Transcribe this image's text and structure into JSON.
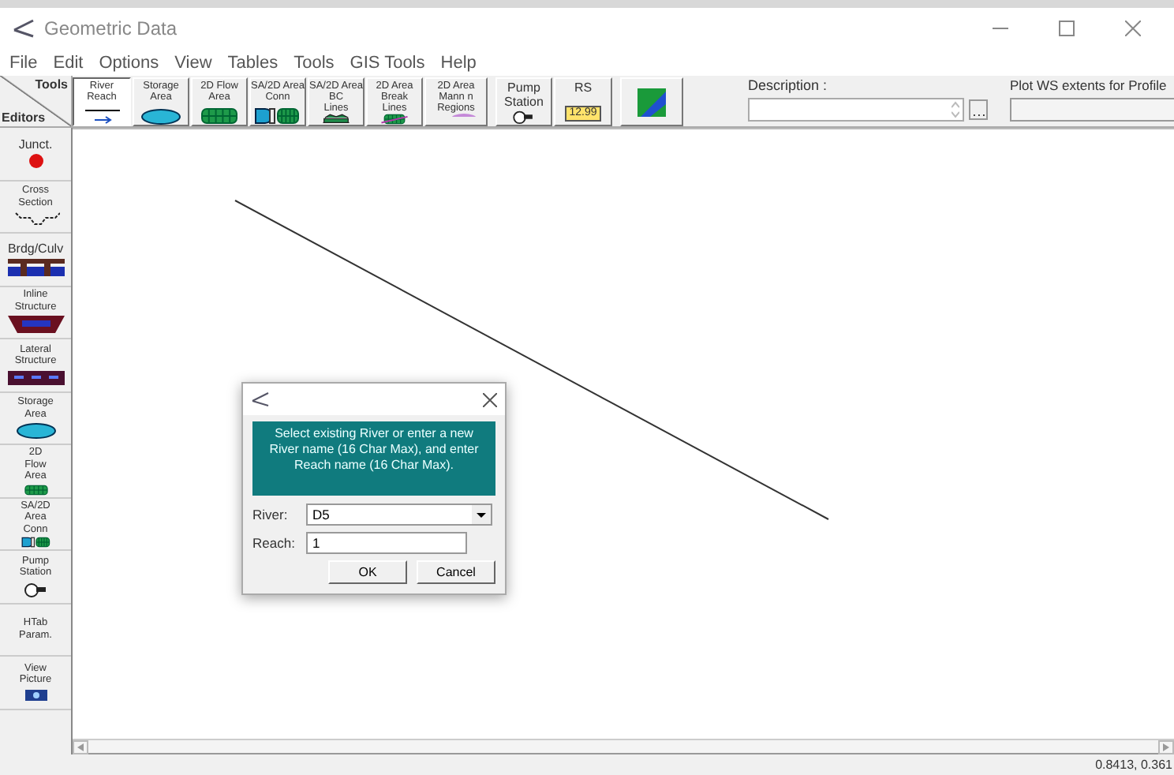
{
  "window": {
    "title": "Geometric Data"
  },
  "menu": [
    "File",
    "Edit",
    "Options",
    "View",
    "Tables",
    "Tools",
    "GIS Tools",
    "Help"
  ],
  "toolbar": {
    "corner_top": "Tools",
    "corner_bottom": "Editors",
    "buttons": [
      {
        "label": "River Reach",
        "kind": "reach",
        "selected": true
      },
      {
        "label": "Storage Area",
        "kind": "storage",
        "selected": false
      },
      {
        "label": "2D Flow Area",
        "kind": "flow2d",
        "selected": false
      },
      {
        "label": "SA/2D Area Conn",
        "kind": "conn",
        "selected": false
      },
      {
        "label": "SA/2D Area BC Lines",
        "kind": "bclines",
        "selected": false
      },
      {
        "label": "2D Area Break Lines",
        "kind": "breaklines",
        "selected": false
      },
      {
        "label": "2D Area Mann n Regions",
        "kind": "mann",
        "selected": false
      },
      {
        "label": "Pump Station",
        "kind": "pump",
        "selected": false
      },
      {
        "label": "RS",
        "kind": "rs",
        "badge": "12.99",
        "selected": false
      },
      {
        "kind": "map",
        "selected": false
      }
    ]
  },
  "description": {
    "label": "Description :"
  },
  "plot_ws": {
    "label": "Plot WS extents for Profile"
  },
  "editors": [
    {
      "label": "Junct.",
      "kind": "junction"
    },
    {
      "label": "Cross Section",
      "kind": "xs"
    },
    {
      "label": "Brdg/Culv",
      "kind": "bridge"
    },
    {
      "label": "Inline Structure",
      "kind": "inline"
    },
    {
      "label": "Lateral Structure",
      "kind": "lateral"
    },
    {
      "label": "Storage Area",
      "kind": "storage"
    },
    {
      "label": "2D Flow Area",
      "kind": "flow2d"
    },
    {
      "label": "SA/2D Area Conn",
      "kind": "conn"
    },
    {
      "label": "Pump Station",
      "kind": "pump"
    },
    {
      "label": "HTab Param.",
      "kind": "text"
    },
    {
      "label": "View Picture",
      "kind": "camera"
    }
  ],
  "dialog": {
    "message": "Select existing River or enter a new River name (16 Char Max), and enter Reach name (16 Char Max).",
    "river": {
      "label": "River:",
      "value": "D5"
    },
    "reach": {
      "label": "Reach:",
      "value": "1"
    },
    "buttons": [
      "OK",
      "Cancel"
    ]
  },
  "status": "0.8413, 0.361"
}
